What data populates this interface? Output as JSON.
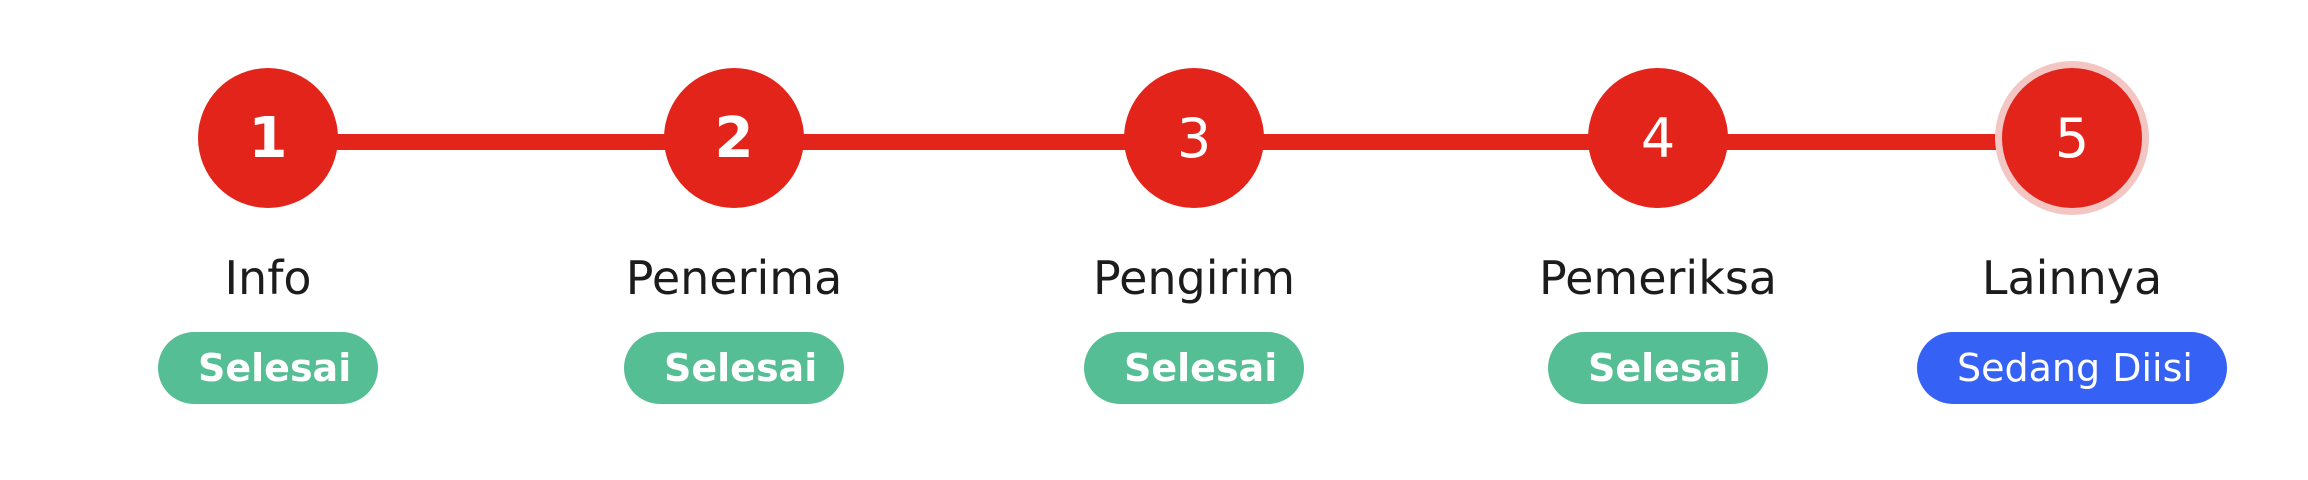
{
  "steps": [
    {
      "number": "1",
      "label": "Info",
      "status": "Selesai"
    },
    {
      "number": "2",
      "label": "Penerima",
      "status": "Selesai"
    },
    {
      "number": "3",
      "label": "Pengirim",
      "status": "Selesai"
    },
    {
      "number": "4",
      "label": "Pemeriksa",
      "status": "Selesai"
    },
    {
      "number": "5",
      "label": "Lainnya",
      "status": "Sedang Diisi"
    }
  ],
  "colors": {
    "step_circle": "#e3241b",
    "connector": "#e3241b",
    "status_done": "#55be94",
    "status_in_progress": "#3562f5",
    "active_ring": "#f3c6c4"
  }
}
